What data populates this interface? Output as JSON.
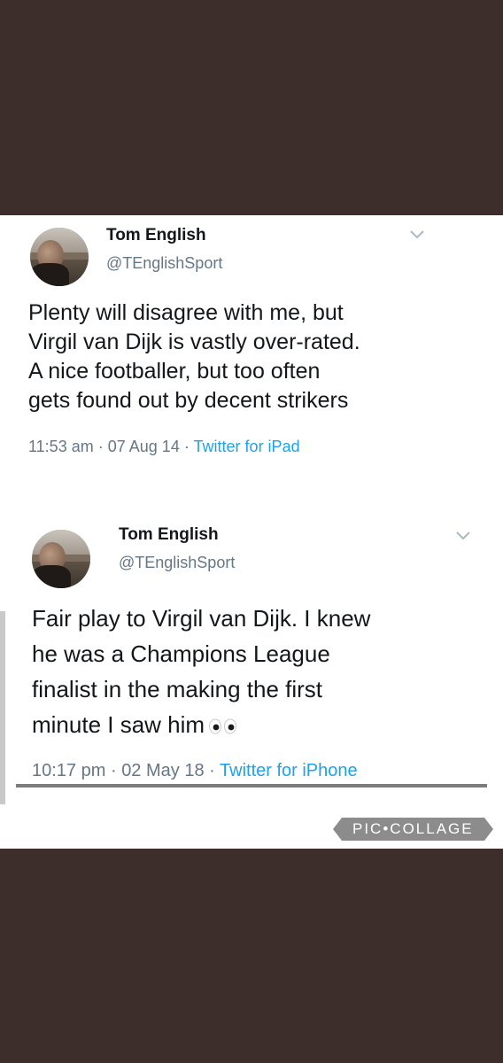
{
  "tweets": [
    {
      "author_name": "Tom English",
      "handle": "@TEnglishSport",
      "text_lines": [
        "Plenty will disagree with me, but",
        "Virgil van Dijk is vastly over-rated.",
        "A nice footballer, but too often",
        "gets found out by decent strikers"
      ],
      "time": "11:53 am",
      "date": "07 Aug 14",
      "separator": "·",
      "source": "Twitter for iPad",
      "emoji": ""
    },
    {
      "author_name": "Tom English",
      "handle": "@TEnglishSport",
      "text_lines": [
        "Fair play to Virgil van Dijk. I knew",
        "he was a Champions League",
        "finalist in the making the first",
        "minute I saw him"
      ],
      "time": "10:17 pm",
      "date": "02 May 18",
      "separator": "·",
      "source": "Twitter for iPhone",
      "emoji": "eyes-emoji"
    }
  ],
  "watermark": {
    "label": "PIC•COLLAGE"
  },
  "colors": {
    "background": "#3d2e2b",
    "card": "#ffffff",
    "name": "#14171a",
    "secondary": "#657786",
    "link": "#1da1f2",
    "watermark": "#8c8c8c"
  },
  "icons": {
    "menu": "chevron-down-icon",
    "avatar": "profile-photo"
  }
}
